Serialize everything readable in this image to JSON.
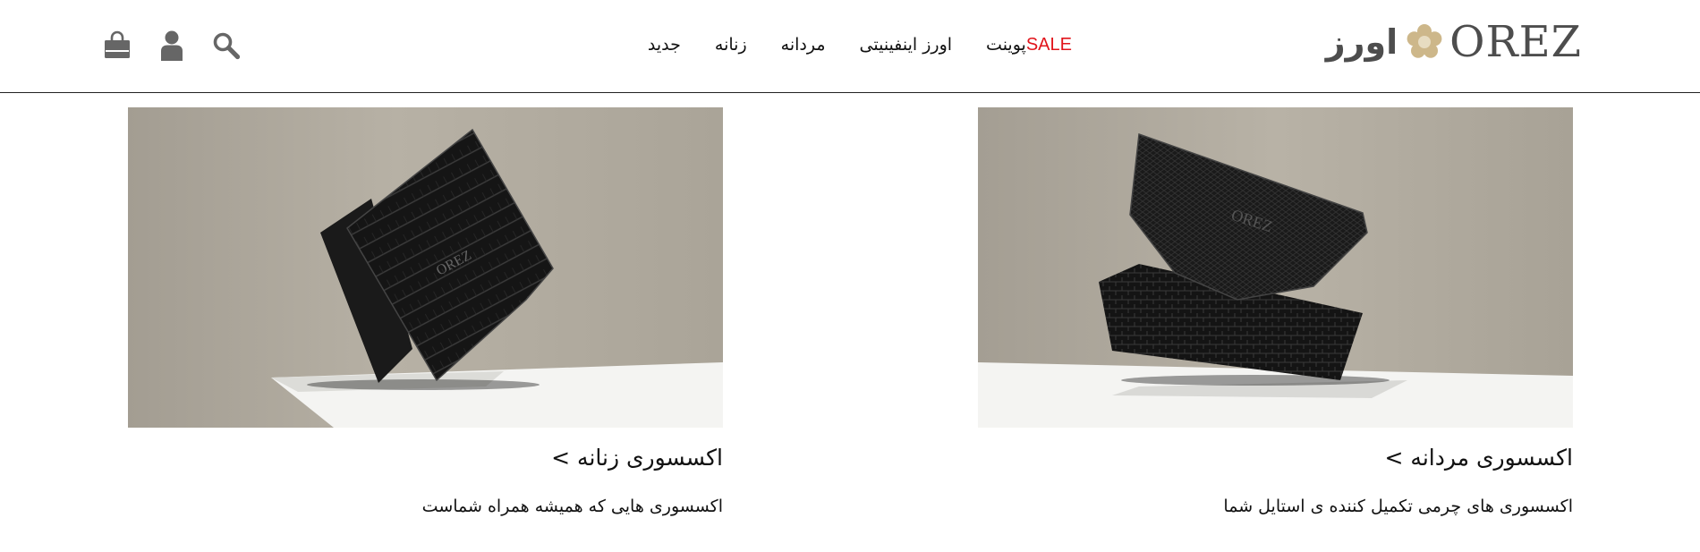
{
  "header": {
    "logo": {
      "latin": "OREZ",
      "farsi": "اورز"
    },
    "nav": [
      {
        "label": "جدید",
        "name": "nav-new"
      },
      {
        "label": "زنانه",
        "name": "nav-women"
      },
      {
        "label": "مردانه",
        "name": "nav-men"
      },
      {
        "label": "اورز اینفینیتی",
        "name": "nav-orez-infinity"
      },
      {
        "label": "پوینت",
        "name": "nav-point"
      },
      {
        "label": "SALE",
        "name": "nav-sale"
      }
    ],
    "icons": [
      "search-icon",
      "user-icon",
      "shopping-bag-icon"
    ]
  },
  "cards": {
    "men": {
      "title": "اکسسوری مردانه >",
      "description": "اکسسوری های چرمی تکمیل کننده ی استایل شما",
      "image_brand": "OREZ"
    },
    "women": {
      "title": "اکسسوری زنانه >",
      "description": "اکسسوری هایی که همیشه همراه شماست",
      "image_brand": "OREZ"
    }
  },
  "colors": {
    "sale": "#e1141b",
    "logo_gray": "#4d4d4d",
    "logo_gold": "#cdb78a",
    "image_background": "#aaa398",
    "header_border": "#222222"
  }
}
